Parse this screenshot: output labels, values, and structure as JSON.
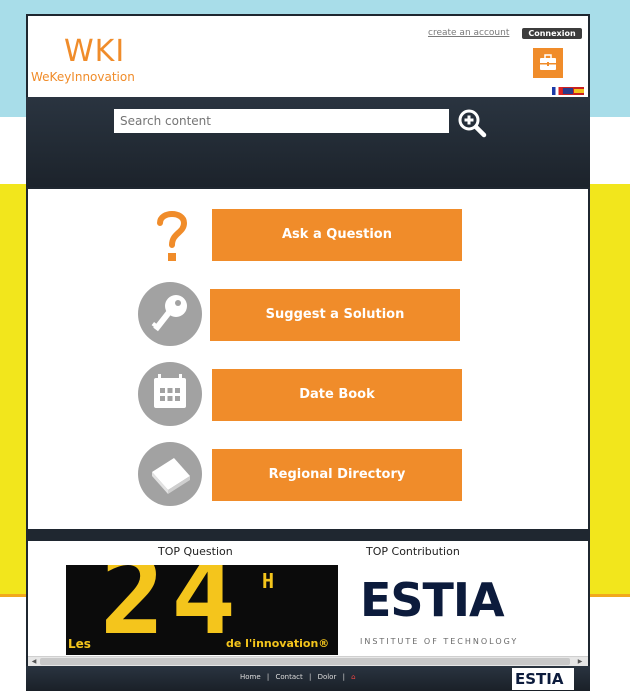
{
  "header": {
    "logo": "WKI",
    "tagline": "WeKeyInnovation",
    "create_account": "create an account",
    "connexion": "Connexion",
    "flags": [
      "fr-flag",
      "en-flag",
      "es-flag"
    ]
  },
  "search": {
    "placeholder": "Search content"
  },
  "actions": [
    {
      "label": "Ask a Question",
      "icon": "question-mark-icon"
    },
    {
      "label": "Suggest a Solution",
      "icon": "key-icon"
    },
    {
      "label": "Date Book",
      "icon": "calendar-icon"
    },
    {
      "label": "Regional Directory",
      "icon": "book-icon"
    }
  ],
  "bottom": {
    "top_question": "TOP Question",
    "top_contribution": "TOP Contribution",
    "les24": {
      "les": "Les",
      "big": "24",
      "sup": "H",
      "sub": "de l'innovation®"
    },
    "estia": {
      "logo": "ESTIA",
      "subtitle": "INSTITUTE OF TECHNOLOGY"
    }
  },
  "footer": {
    "links": [
      "Home",
      "Contact",
      "Dolor"
    ],
    "separator": "|",
    "logo": "ESTIA"
  },
  "colors": {
    "accent": "#f08c2a",
    "dark": "#1f2730",
    "sky": "#a8dde9",
    "yellow": "#f2e61c",
    "icon_gray": "#a2a2a2"
  }
}
